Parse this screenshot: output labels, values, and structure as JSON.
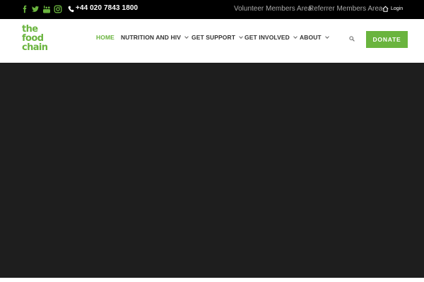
{
  "topbar": {
    "social": [
      "facebook-icon",
      "twitter-icon",
      "youtube-icon",
      "instagram-icon"
    ],
    "phone": "+44 020 7843 1800",
    "volunteer_link": "Volunteer Members Area",
    "referrer_link": "Referrer Members Area",
    "login": "Login"
  },
  "logo": {
    "line1": "the",
    "line2": "food",
    "line3": "chain"
  },
  "nav": {
    "items": [
      {
        "label": "HOME",
        "active": true
      },
      {
        "label": "NUTRITION AND HIV"
      },
      {
        "label": "GET SUPPORT"
      },
      {
        "label": "GET INVOLVED"
      },
      {
        "label": "ABOUT"
      }
    ],
    "donate": "DONATE"
  },
  "colors": {
    "brand_green": "#6ab43e",
    "topbar_bg": "#000000",
    "hero_bg": "#1e1e1e"
  }
}
